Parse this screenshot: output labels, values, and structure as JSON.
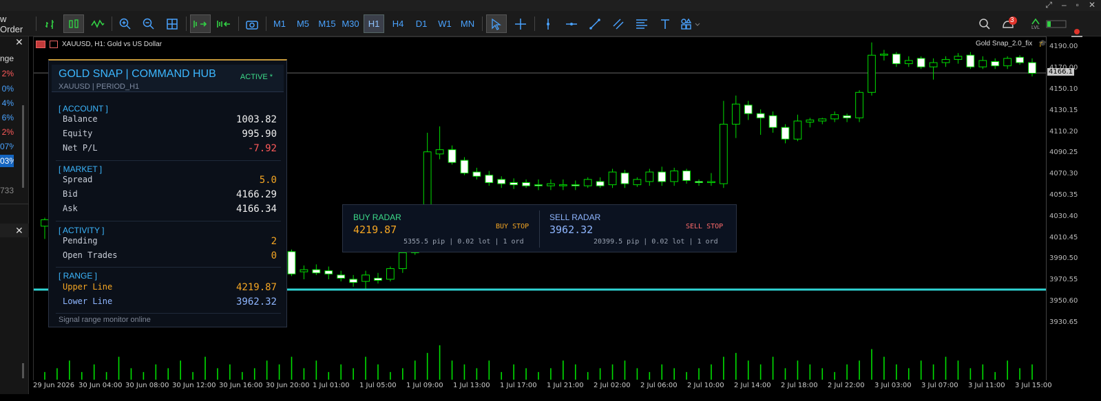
{
  "toolbar": {
    "new_order_label": "w Order",
    "timeframes": [
      "M1",
      "M5",
      "M15",
      "M30",
      "H1",
      "H4",
      "D1",
      "W1",
      "MN"
    ],
    "selected_timeframe": "H1",
    "notification_count": "3",
    "lvl_label": "LVL"
  },
  "left_panel": {
    "header": "nge",
    "values": [
      {
        "text": "2%",
        "color": "#ff5a5a"
      },
      {
        "text": "0%",
        "color": "#4aa3ff"
      },
      {
        "text": "4%",
        "color": "#4aa3ff"
      },
      {
        "text": "6%",
        "color": "#4aa3ff"
      },
      {
        "text": "2%",
        "color": "#ff5a5a"
      },
      {
        "text": "07%",
        "color": "#4aa3ff"
      },
      {
        "text": "03%",
        "color": "#ffffff"
      }
    ],
    "footer_value": "733"
  },
  "chart": {
    "symbol_label": "XAUUSD, H1:  Gold vs US Dollar",
    "ea_label": "Gold Snap_2.0_fix",
    "current_price": "4166.1",
    "price_axis": [
      "4190.00",
      "4170.00",
      "4150.10",
      "4130.15",
      "4110.20",
      "4090.25",
      "4070.30",
      "4050.35",
      "4030.40",
      "4010.45",
      "3990.50",
      "3970.55",
      "3950.60",
      "3930.65"
    ],
    "time_axis": [
      "29 Jun 2026",
      "30 Jun 04:00",
      "30 Jun 08:00",
      "30 Jun 12:00",
      "30 Jun 16:00",
      "30 Jun 20:00",
      "1 Jul 01:00",
      "1 Jul 05:00",
      "1 Jul 09:00",
      "1 Jul 13:00",
      "1 Jul 17:00",
      "1 Jul 21:00",
      "2 Jul 02:00",
      "2 Jul 06:00",
      "2 Jul 10:00",
      "2 Jul 14:00",
      "2 Jul 18:00",
      "2 Jul 22:00",
      "3 Jul 03:00",
      "3 Jul 07:00",
      "3 Jul 11:00",
      "3 Jul 15:00"
    ],
    "lower_line_color": "#2fd4d4",
    "candle_up_color": "#00e000"
  },
  "hub": {
    "title": "GOLD SNAP | COMMAND HUB",
    "status": "ACTIVE  *",
    "subtitle": "XAUUSD | PERIOD_H1",
    "account_header": "[ ACCOUNT ]",
    "balance_label": "Balance",
    "balance": "1003.82",
    "equity_label": "Equity",
    "equity": "995.90",
    "netpl_label": "Net P/L",
    "netpl": "-7.92",
    "market_header": "[ MARKET ]",
    "spread_label": "Spread",
    "spread": "5.0",
    "bid_label": "Bid",
    "bid": "4166.29",
    "ask_label": "Ask",
    "ask": "4166.34",
    "activity_header": "[ ACTIVITY ]",
    "pending_label": "Pending",
    "pending": "2",
    "open_trades_label": "Open Trades",
    "open_trades": "0",
    "range_header": "[ RANGE ]",
    "upper_label": "Upper Line",
    "upper": "4219.87",
    "lower_label": "Lower Line",
    "lower": "3962.32",
    "footer": "Signal range monitor online"
  },
  "radar": {
    "buy_title": "BUY RADAR",
    "buy_price": "4219.87",
    "buy_type": "BUY STOP",
    "buy_info": "5355.5 pip | 0.02 lot | 1 ord",
    "sell_title": "SELL RADAR",
    "sell_price": "3962.32",
    "sell_type": "SELL STOP",
    "sell_info": "20399.5 pip | 0.02 lot | 1 ord"
  },
  "chart_data": {
    "type": "candlestick",
    "symbol": "XAUUSD",
    "timeframe": "H1",
    "ylim": [
      3915,
      4200
    ],
    "lines": [
      {
        "name": "Lower Line",
        "value": 3962.32
      },
      {
        "name": "Bid",
        "value": 4166.29
      }
    ],
    "candles": [
      {
        "o": 4022,
        "h": 4030,
        "l": 4010,
        "c": 4028
      },
      {
        "o": 4030,
        "h": 4042,
        "l": 3950,
        "c": 4020
      },
      {
        "o": 4025,
        "h": 4035,
        "l": 4015,
        "c": 4030
      },
      {
        "o": 4028,
        "h": 4033,
        "l": 4017,
        "c": 4022
      },
      {
        "o": 4027,
        "h": 4032,
        "l": 4020,
        "c": 4030
      },
      {
        "o": 4030,
        "h": 4036,
        "l": 4020,
        "c": 4025
      },
      {
        "o": 4028,
        "h": 4034,
        "l": 4018,
        "c": 4020
      },
      {
        "o": 4032,
        "h": 4038,
        "l": 4022,
        "c": 4030
      },
      {
        "o": 4030,
        "h": 4035,
        "l": 4024,
        "c": 4028
      },
      {
        "o": 4029,
        "h": 4034,
        "l": 4020,
        "c": 4022
      },
      {
        "o": 4031,
        "h": 4035,
        "l": 4020,
        "c": 4024
      },
      {
        "o": 4030,
        "h": 4034,
        "l": 4020,
        "c": 4022
      },
      {
        "o": 4029,
        "h": 4035,
        "l": 4020,
        "c": 4026
      },
      {
        "o": 4028,
        "h": 4033,
        "l": 4018,
        "c": 4020
      },
      {
        "o": 4025,
        "h": 4030,
        "l": 4018,
        "c": 4022
      },
      {
        "o": 4030,
        "h": 4033,
        "l": 4015,
        "c": 4016
      },
      {
        "o": 4020,
        "h": 4025,
        "l": 4005,
        "c": 4010
      },
      {
        "o": 4018,
        "h": 4022,
        "l": 4010,
        "c": 4012
      },
      {
        "o": 4012,
        "h": 4018,
        "l": 4002,
        "c": 4005
      },
      {
        "o": 4005,
        "h": 4010,
        "l": 3990,
        "c": 3993
      },
      {
        "o": 3998,
        "h": 4000,
        "l": 3975,
        "c": 3977
      },
      {
        "o": 3979,
        "h": 3985,
        "l": 3972,
        "c": 3981
      },
      {
        "o": 3981,
        "h": 3986,
        "l": 3976,
        "c": 3978
      },
      {
        "o": 3980,
        "h": 3984,
        "l": 3972,
        "c": 3977
      },
      {
        "o": 3976,
        "h": 3980,
        "l": 3970,
        "c": 3973
      },
      {
        "o": 3972,
        "h": 3976,
        "l": 3965,
        "c": 3969
      },
      {
        "o": 3970,
        "h": 3980,
        "l": 3962,
        "c": 3976
      },
      {
        "o": 3973,
        "h": 3978,
        "l": 3968,
        "c": 3971
      },
      {
        "o": 3972,
        "h": 3984,
        "l": 3970,
        "c": 3982
      },
      {
        "o": 3982,
        "h": 4000,
        "l": 3978,
        "c": 3997
      },
      {
        "o": 3997,
        "h": 4030,
        "l": 3995,
        "c": 4028
      },
      {
        "o": 4028,
        "h": 4110,
        "l": 4010,
        "c": 4092
      },
      {
        "o": 4090,
        "h": 4116,
        "l": 4085,
        "c": 4094
      },
      {
        "o": 4094,
        "h": 4098,
        "l": 4080,
        "c": 4082
      },
      {
        "o": 4084,
        "h": 4087,
        "l": 4070,
        "c": 4072
      },
      {
        "o": 4073,
        "h": 4077,
        "l": 4066,
        "c": 4069
      },
      {
        "o": 4070,
        "h": 4074,
        "l": 4060,
        "c": 4063
      },
      {
        "o": 4066,
        "h": 4069,
        "l": 4058,
        "c": 4062
      },
      {
        "o": 4063,
        "h": 4067,
        "l": 4057,
        "c": 4061
      },
      {
        "o": 4063,
        "h": 4066,
        "l": 4058,
        "c": 4060
      },
      {
        "o": 4061,
        "h": 4066,
        "l": 4056,
        "c": 4060
      },
      {
        "o": 4060,
        "h": 4066,
        "l": 4056,
        "c": 4062
      },
      {
        "o": 4060,
        "h": 4066,
        "l": 4056,
        "c": 4061
      },
      {
        "o": 4061,
        "h": 4065,
        "l": 4056,
        "c": 4060
      },
      {
        "o": 4060,
        "h": 4068,
        "l": 4058,
        "c": 4066
      },
      {
        "o": 4064,
        "h": 4068,
        "l": 4058,
        "c": 4060
      },
      {
        "o": 4061,
        "h": 4076,
        "l": 4058,
        "c": 4073
      },
      {
        "o": 4072,
        "h": 4075,
        "l": 4058,
        "c": 4062
      },
      {
        "o": 4061,
        "h": 4068,
        "l": 4059,
        "c": 4066
      },
      {
        "o": 4064,
        "h": 4076,
        "l": 4060,
        "c": 4073
      },
      {
        "o": 4073,
        "h": 4078,
        "l": 4060,
        "c": 4064
      },
      {
        "o": 4064,
        "h": 4077,
        "l": 4060,
        "c": 4074
      },
      {
        "o": 4074,
        "h": 4076,
        "l": 4062,
        "c": 4065
      },
      {
        "o": 4064,
        "h": 4066,
        "l": 4060,
        "c": 4063
      },
      {
        "o": 4063,
        "h": 4072,
        "l": 4060,
        "c": 4064
      },
      {
        "o": 4062,
        "h": 4140,
        "l": 4058,
        "c": 4118
      },
      {
        "o": 4118,
        "h": 4145,
        "l": 4105,
        "c": 4137
      },
      {
        "o": 4136,
        "h": 4140,
        "l": 4122,
        "c": 4128
      },
      {
        "o": 4128,
        "h": 4132,
        "l": 4108,
        "c": 4124
      },
      {
        "o": 4126,
        "h": 4130,
        "l": 4110,
        "c": 4115
      },
      {
        "o": 4115,
        "h": 4118,
        "l": 4100,
        "c": 4104
      },
      {
        "o": 4104,
        "h": 4127,
        "l": 4102,
        "c": 4121
      },
      {
        "o": 4120,
        "h": 4124,
        "l": 4115,
        "c": 4122
      },
      {
        "o": 4121,
        "h": 4124,
        "l": 4118,
        "c": 4123
      },
      {
        "o": 4123,
        "h": 4130,
        "l": 4120,
        "c": 4127
      },
      {
        "o": 4126,
        "h": 4128,
        "l": 4120,
        "c": 4124
      },
      {
        "o": 4124,
        "h": 4150,
        "l": 4120,
        "c": 4148
      },
      {
        "o": 4148,
        "h": 4195,
        "l": 4145,
        "c": 4183
      },
      {
        "o": 4183,
        "h": 4188,
        "l": 4178,
        "c": 4184
      },
      {
        "o": 4184,
        "h": 4186,
        "l": 4172,
        "c": 4175
      },
      {
        "o": 4175,
        "h": 4182,
        "l": 4172,
        "c": 4178
      },
      {
        "o": 4180,
        "h": 4182,
        "l": 4170,
        "c": 4172
      },
      {
        "o": 4172,
        "h": 4180,
        "l": 4160,
        "c": 4176
      },
      {
        "o": 4176,
        "h": 4182,
        "l": 4172,
        "c": 4179
      },
      {
        "o": 4179,
        "h": 4185,
        "l": 4175,
        "c": 4182
      },
      {
        "o": 4183,
        "h": 4186,
        "l": 4170,
        "c": 4172
      },
      {
        "o": 4172,
        "h": 4182,
        "l": 4170,
        "c": 4178
      },
      {
        "o": 4177,
        "h": 4180,
        "l": 4170,
        "c": 4173
      },
      {
        "o": 4173,
        "h": 4182,
        "l": 4170,
        "c": 4180
      },
      {
        "o": 4181,
        "h": 4183,
        "l": 4174,
        "c": 4176
      },
      {
        "o": 4176,
        "h": 4180,
        "l": 4163,
        "c": 4166
      }
    ],
    "volumes": [
      2,
      3,
      5,
      2,
      4,
      2,
      6,
      3,
      2,
      4,
      3,
      5,
      2,
      6,
      3,
      4,
      2,
      3,
      5,
      4,
      6,
      3,
      5,
      2,
      4,
      3,
      6,
      4,
      2,
      3,
      5,
      7,
      9,
      5,
      4,
      3,
      5,
      2,
      4,
      3,
      2,
      3,
      5,
      4,
      2,
      3,
      4,
      5,
      3,
      2,
      4,
      3,
      2,
      3,
      4,
      6,
      7,
      5,
      4,
      6,
      3,
      5,
      4,
      3,
      2,
      4,
      5,
      8,
      6,
      4,
      3,
      5,
      4,
      6,
      5,
      3,
      4,
      2,
      5,
      3,
      4
    ]
  }
}
